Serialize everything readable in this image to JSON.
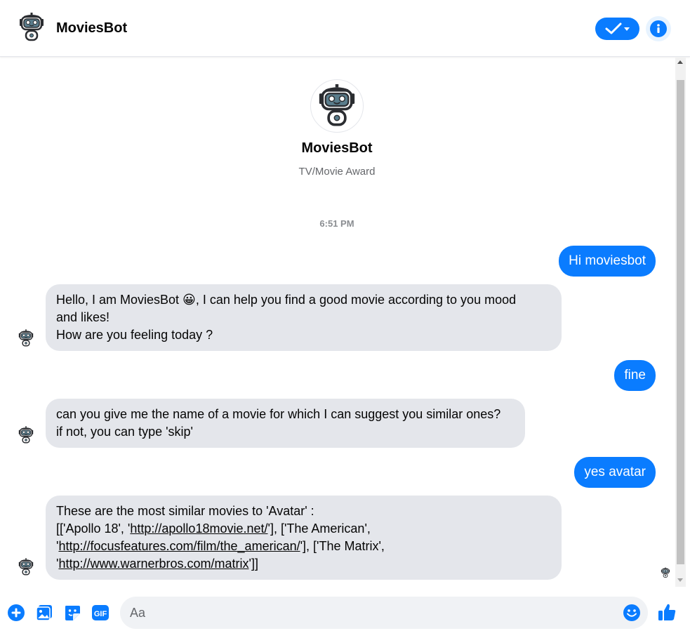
{
  "header": {
    "title": "MoviesBot",
    "avatar_icon": "robot-icon",
    "check_icon": "checkmark-dropdown-icon",
    "info_icon": "info-icon"
  },
  "profile": {
    "name": "MoviesBot",
    "subtitle": "TV/Movie Award"
  },
  "timestamp": "6:51 PM",
  "messages": {
    "m1": "Hi moviesbot",
    "m2_line1": "Hello, I am MoviesBot 😀, I can help you find a good movie according to you mood",
    "m2_line2": "and likes!",
    "m2_line3": "How are you feeling today ?",
    "m3": "fine",
    "m4_line1": "can you give me the name of a movie for which I can suggest you similar ones?",
    "m4_line2": "if not, you can type 'skip'",
    "m5": "yes avatar",
    "m6_line1": "These are the most similar movies to 'Avatar' :",
    "m6_pre1": "[['Apollo 18', '",
    "m6_link1": "http://apollo18movie.net/",
    "m6_mid1": "'], ['The American',",
    "m6_pre2": "'",
    "m6_link2": "http://focusfeatures.com/film/the_american/",
    "m6_mid2": "'], ['The Matrix',",
    "m6_pre3": "'",
    "m6_link3": "http://www.warnerbros.com/matrix",
    "m6_end": "']]"
  },
  "composer": {
    "placeholder": "Aa",
    "icons": [
      "plus-icon",
      "photo-icon",
      "sticker-icon",
      "gif-icon",
      "emoji-icon",
      "thumbs-up-icon"
    ],
    "gif_label": "GIF"
  },
  "colors": {
    "accent": "#0a7cff",
    "bubble_in": "#e4e6eb",
    "secondary_text": "#65676b"
  }
}
